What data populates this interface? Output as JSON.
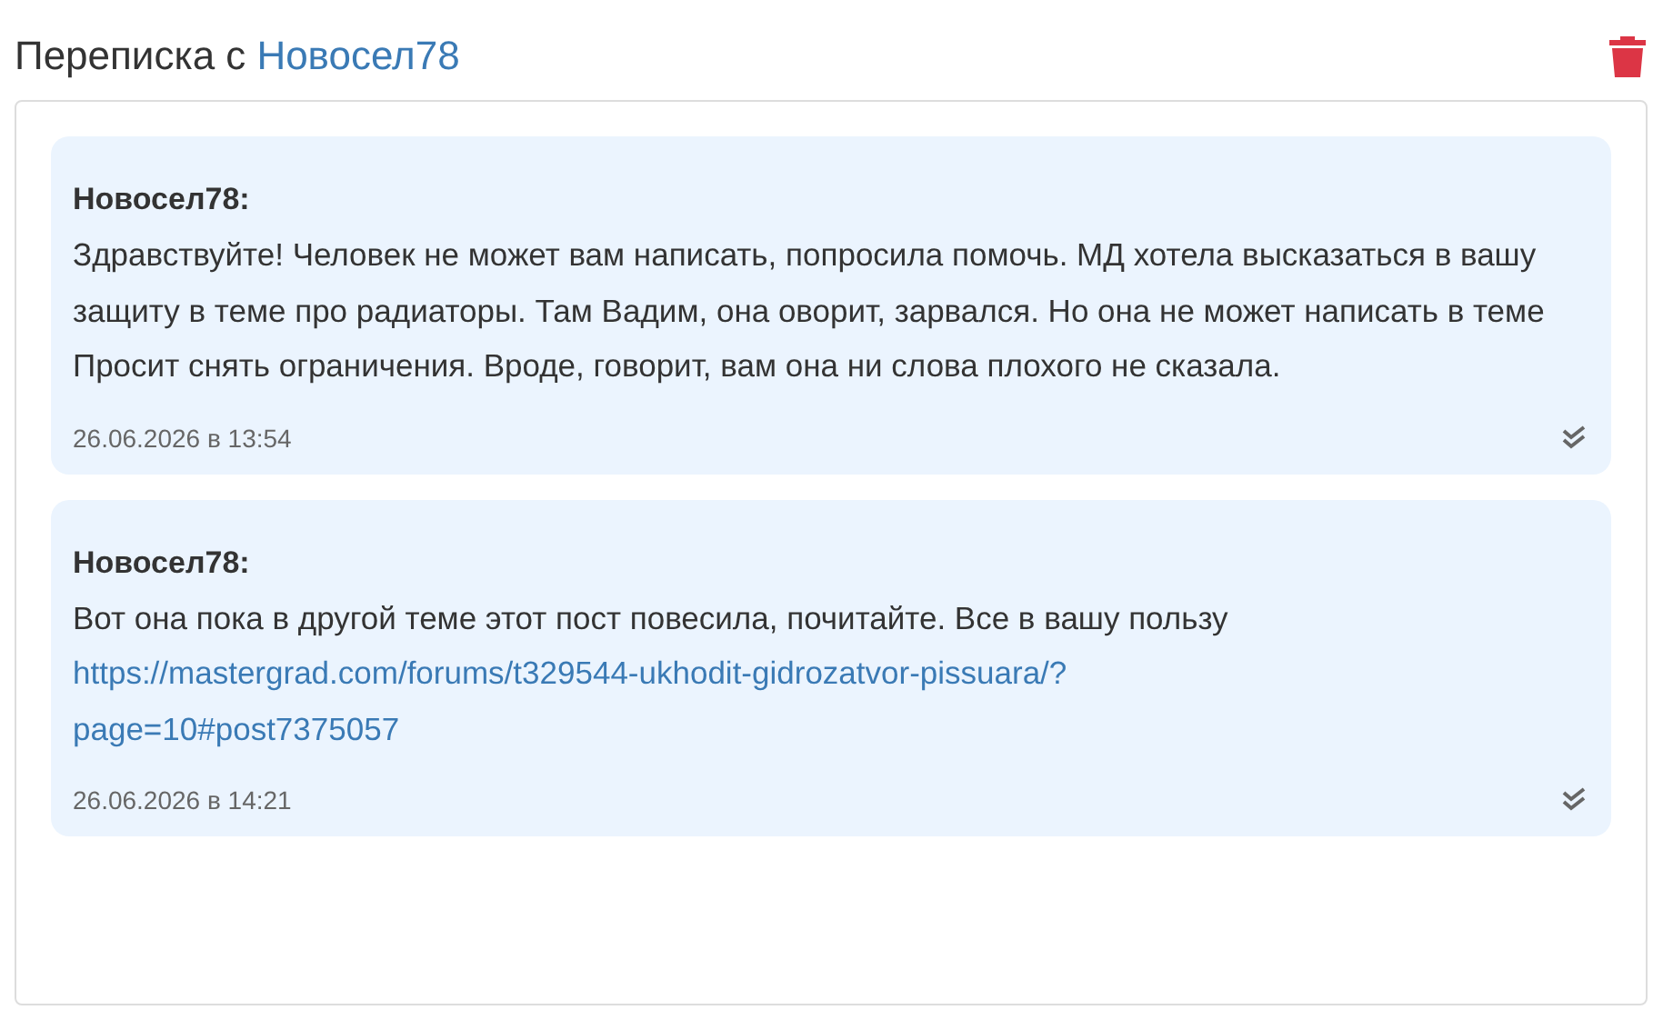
{
  "header": {
    "title": "Переписка с",
    "user": "Новосел78"
  },
  "messages": [
    {
      "author": "Новосел78:",
      "text": "Здравствуйте! Человек не может вам написать, попросила помочь. МД хотела высказаться в вашу защиту в теме про радиаторы. Там Вадим, она оворит, зарвался. Но она не может написать в теме Просит снять ограничения. Вроде, говорит, вам она ни слова плохого не сказала.",
      "time": "26.06.2026 в 13:54",
      "read": true
    },
    {
      "author": "Новосел78:",
      "text": "Вот она пока в другой теме этот пост повесила, почитайте. Все в вашу пользу",
      "link": "https://mastergrad.com/forums/t329544-ukhodit-gidrozatvor-pissuara/?page=10#post7375057",
      "time": "26.06.2026 в 14:21",
      "read": true
    }
  ]
}
